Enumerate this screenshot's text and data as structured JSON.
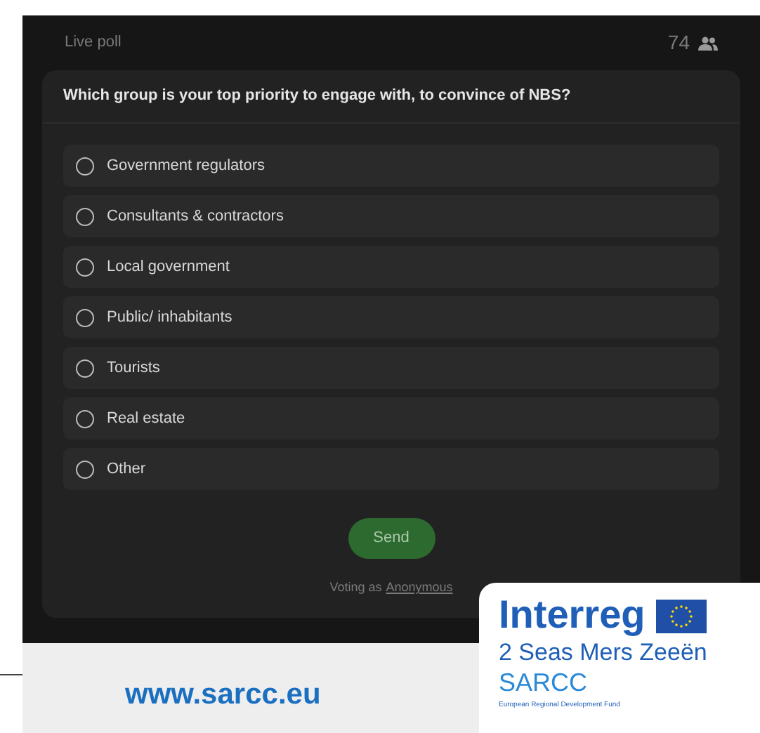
{
  "header": {
    "title": "Live poll",
    "participant_count": "74"
  },
  "poll": {
    "question": "Which group is your top priority to engage with, to convince of NBS?",
    "options": [
      {
        "label": "Government regulators",
        "selected": false
      },
      {
        "label": "Consultants & contractors",
        "selected": false
      },
      {
        "label": "Local government",
        "selected": false
      },
      {
        "label": "Public/ inhabitants",
        "selected": false
      },
      {
        "label": "Tourists",
        "selected": false
      },
      {
        "label": "Real estate",
        "selected": false
      },
      {
        "label": "Other",
        "selected": false
      }
    ],
    "send_button": "Send",
    "voting_prefix": "Voting as",
    "voting_link": "Anonymous"
  },
  "footer": {
    "website": "www.sarcc.eu"
  },
  "logo": {
    "brand": "Interreg",
    "programme": "2 Seas Mers Zeeën",
    "project": "SARCC",
    "fund": "European Regional Development Fund"
  }
}
